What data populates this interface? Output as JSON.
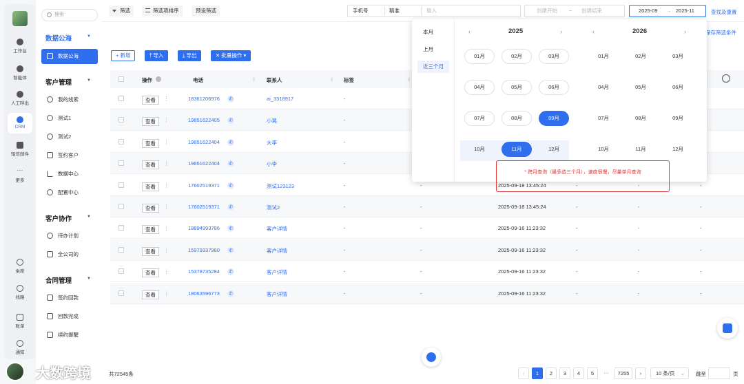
{
  "rail": [
    {
      "label": "工作台",
      "icon": "workbench-icon"
    },
    {
      "label": "智能体",
      "icon": "agent-icon"
    },
    {
      "label": "人工呼出",
      "icon": "call-out-icon"
    },
    {
      "label": "CRM",
      "icon": "crm-icon"
    },
    {
      "label": "短信邮件",
      "icon": "message-icon"
    },
    {
      "label": "更多",
      "icon": "more-icon"
    },
    {
      "label": "坐席",
      "icon": "headset-icon"
    },
    {
      "label": "线路",
      "icon": "line-icon"
    },
    {
      "label": "账单",
      "icon": "bill-icon"
    },
    {
      "label": "通知",
      "icon": "bell-icon"
    }
  ],
  "menu": {
    "search_placeholder": "搜索",
    "groups": [
      {
        "title": "数据公海",
        "items": [
          "数据公海"
        ]
      },
      {
        "title": "客户管理",
        "items": [
          "我的线索",
          "测试1",
          "测试2",
          "签约客户",
          "数据中心",
          "配置中心"
        ]
      },
      {
        "title": "客户协作",
        "items": [
          "待办计划",
          "全公司的"
        ]
      },
      {
        "title": "合同管理",
        "items": [
          "签约回款",
          "回款完成",
          "续约提醒"
        ]
      }
    ]
  },
  "topbar": {
    "filter": "筛选",
    "sort": "筛选项排序",
    "preset": "预设筛选",
    "field": "手机号",
    "match": "精准",
    "input_placeholder": "填入",
    "create_start": "创建开始",
    "tilde": "~",
    "create_end": "创建结束",
    "month_start": "2025-09",
    "arrow": "→",
    "month_end": "2025-11",
    "search_reset": "查找及重置",
    "save_filter": "保存筛选条件"
  },
  "actions": {
    "add": "+ 新增",
    "import": "导入",
    "export": "导出",
    "batch": "批量操作 ▾"
  },
  "table": {
    "headers": [
      "操作",
      "电话",
      "联系人",
      "标签"
    ],
    "view_label": "查看",
    "rows": [
      {
        "phone": "18361206976",
        "contact": "ai_3318917",
        "tag": "-",
        "time": "",
        "extra": ""
      },
      {
        "phone": "19851622405",
        "contact": "小晃",
        "tag": "-",
        "time": "",
        "extra": ""
      },
      {
        "phone": "19851622404",
        "contact": "大李",
        "tag": "-",
        "time": "",
        "extra": ""
      },
      {
        "phone": "19851622404",
        "contact": "小李",
        "tag": "-",
        "time": "",
        "extra": ""
      },
      {
        "phone": "17602519371",
        "contact": "测试123123",
        "tag": "-",
        "time": "2025-09-18 13:45:24",
        "extra": "-"
      },
      {
        "phone": "17602519371",
        "contact": "测试2",
        "tag": "-",
        "time": "2025-09-18 13:45:24",
        "extra": "-"
      },
      {
        "phone": "18894993786",
        "contact": "客户详情",
        "tag": "-",
        "time": "2025-09-16 11:23:32",
        "extra": "-"
      },
      {
        "phone": "15979337980",
        "contact": "客户详情",
        "tag": "-",
        "time": "2025-09-16 11:23:32",
        "extra": "-"
      },
      {
        "phone": "15378735284",
        "contact": "客户详情",
        "tag": "-",
        "time": "2025-09-16 11:23:32",
        "extra": "-"
      },
      {
        "phone": "18063596773",
        "contact": "客户详情",
        "tag": "-",
        "time": "2025-09-16 11:23:32",
        "extra": "-"
      }
    ]
  },
  "footer": {
    "total": "共72545条",
    "pages": [
      "1",
      "2",
      "3",
      "4",
      "5",
      "···",
      "7255"
    ],
    "page_size": "10 条/页",
    "goto": "跳至",
    "page_unit": "页"
  },
  "popup": {
    "presets": [
      "本月",
      "上月",
      "近三个月"
    ],
    "year_left": "2025",
    "year_right": "2026",
    "months": [
      "01月",
      "02月",
      "03月",
      "04月",
      "05月",
      "06月",
      "07月",
      "08月",
      "09月",
      "10月",
      "11月",
      "12月"
    ],
    "warning": "* 跨月查询（最多选三个月），速度很慢，尽量单月查询"
  },
  "watermark": "大数跨境",
  "colors": {
    "accent": "#2f6fed",
    "warn": "#e03a3a"
  }
}
